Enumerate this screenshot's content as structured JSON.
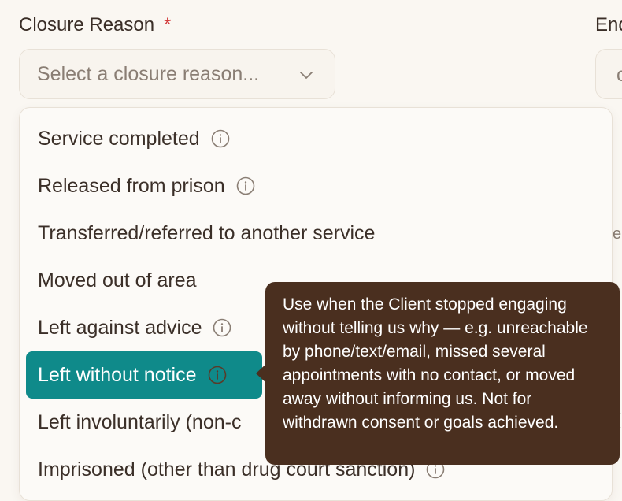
{
  "form": {
    "closure_reason_label": "Closure Reason",
    "required_marker": "*",
    "right_label_fragment": "End",
    "right_input_fragment": "c",
    "right_text_fragment_1": "e",
    "right_text_fragment_2": "(",
    "select_placeholder": "Select a closure reason..."
  },
  "dropdown": {
    "options": [
      {
        "label": "Service completed",
        "has_info": true
      },
      {
        "label": "Released from prison",
        "has_info": true
      },
      {
        "label": "Transferred/referred to another service",
        "has_info": false
      },
      {
        "label": "Moved out of area",
        "has_info": false
      },
      {
        "label": "Left against advice",
        "has_info": true
      },
      {
        "label": "Left without notice",
        "has_info": true,
        "selected": true
      },
      {
        "label": "Left involuntarily (non-c",
        "has_info": false
      },
      {
        "label": "Imprisoned (other than drug court sanction)",
        "has_info": true
      }
    ]
  },
  "tooltip": {
    "text": "Use when the Client stopped engaging without telling us why — e.g. unreachable by phone/text/email, missed several appointments with no contact, or moved away without informing us. Not for withdrawn consent or goals achieved."
  },
  "colors": {
    "selected_bg": "#0f8a8a",
    "tooltip_bg": "#4a2f1f",
    "required": "#d23b3b"
  }
}
